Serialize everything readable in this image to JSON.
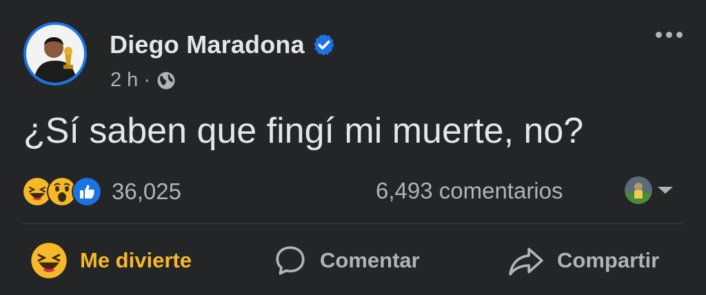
{
  "post": {
    "author": "Diego Maradona",
    "time": "2 h",
    "separator": "·",
    "text": "¿Sí saben que fingí mi muerte, no?"
  },
  "stats": {
    "reactions_count": "36,025",
    "comments": "6,493 comentarios",
    "reaction_icons": [
      "haha-icon",
      "wow-icon",
      "like-icon"
    ]
  },
  "actions": {
    "react_label": "Me divierte",
    "comment_label": "Comentar",
    "share_label": "Compartir"
  },
  "colors": {
    "background": "#242526",
    "primary_text": "#e4e6eb",
    "secondary_text": "#b0b3b8",
    "verified_blue": "#1b74e4",
    "haha_yellow": "#f7b928"
  }
}
